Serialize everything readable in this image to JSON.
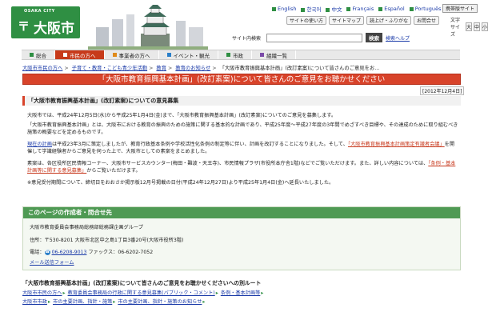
{
  "header": {
    "city_en": "OSAKA CITY",
    "city_mark": "〒",
    "city_jp": "大阪市",
    "languages": [
      "English",
      "한국어",
      "中文",
      "Français",
      "Español",
      "Português"
    ],
    "mobile_label": "携帯版サイト",
    "utility": [
      "サイトの使い方",
      "サイトマップ",
      "読上げ・ふりがな",
      "お問合せ"
    ],
    "fontsize_label": "文字サイズ",
    "fontsize_buttons": [
      "大",
      "中",
      "小"
    ],
    "search_label": "サイト内検索",
    "search_value": "",
    "search_button": "検索",
    "search_help": "検索ヘルプ"
  },
  "nav": [
    {
      "label": "総合",
      "color": "#2f8f43"
    },
    {
      "label": "市民の方へ",
      "color": "#c73a1a"
    },
    {
      "label": "事業者の方へ",
      "color": "#e08a1a"
    },
    {
      "label": "イベント・観光",
      "color": "#2a7fc9"
    },
    {
      "label": "市政",
      "color": "#2f8f43"
    },
    {
      "label": "組織一覧",
      "color": "#7a4aa8"
    }
  ],
  "breadcrumb": [
    "大阪市市民の方へ",
    "子育て・教育・こども青少年活動",
    "教育",
    "教育のお知らせ",
    "「大阪市教育振興基本計画」(改訂素案)について皆さんのご意見をお..."
  ],
  "page_title": "「大阪市教育振興基本計画」(改訂素案)について皆さんのご意見をお聴かせください",
  "date": "[2012年12月4日]",
  "section_title": "「大阪市教育振興基本計画」(改訂素案)についての意見募集",
  "paragraphs": {
    "p1": "大阪市では、平成24年12月5日(水)から平成25年1月4日(金)まで、「大阪市教育振興基本計画」(改訂素案)についてのご意見を募集します。",
    "p2": "「大阪市教育振興基本計画」とは、大阪市における教育の振興のための施策に関する基本的な計画であり、平成25年度～平成27年度の3年間でめざすべき目標や、その達成のために取り組むべき施策の概要などを定めるものです。",
    "p3_link1": "現在の計画",
    "p3_mid": "は平成23年3月に策定しましたが、教育行政基本条例や学校活性化条例の制定等に伴い、計画を改訂することになりました。そして、",
    "p3_link2": "「大阪市教育振興基本計画策定有識者会議」",
    "p3_end": "を開催して学識経験者からご意見を伺った上で、大阪市としての素案をまとめました。",
    "p4_start": "素案は、各区役所区民情報コーナー、大阪市サービスカウンター(梅田・難波・天王寺)、市民情報プラザ(市役所本庁舎1階)などでご覧いただけます。また、詳しい内容については、",
    "p4_link": "「条例・基本計画等に関する意見募集」",
    "p4_end": "からご覧いただけます。",
    "p5": "※意見受付期間について、締切日をおおさか掲示板12月号掲載の日付(平成24年12月27日)より平成25年1月4日(金)へ延長いたしました。"
  },
  "contact": {
    "heading": "このページの作成者・問合せ先",
    "dept": "大阪市教育委員会事務局総務部総務課企画グループ",
    "address": "住所：〒530-8201 大阪市北区中之島1丁目3番20号(大阪市役所3階)",
    "phone_label": "電話：",
    "phone": "06-6208-9013",
    "fax": "ファックス：06-6202-7052",
    "mail_link": "メール送信フォーム"
  },
  "related": {
    "title": "「大阪市教育振興基本計画」(改訂素案)について皆さんのご意見をお聴かせくださいへの別ルート",
    "row1": [
      "大阪市市民の方へ",
      "教育委員会事務局の行政に関する意見募集(パブリック・コメント)",
      "条例・基本計画等"
    ],
    "row2": [
      "大阪市市政",
      "市の主要計画、指針・施策",
      "市の主要計画、指針・施策のお知らせ"
    ]
  }
}
